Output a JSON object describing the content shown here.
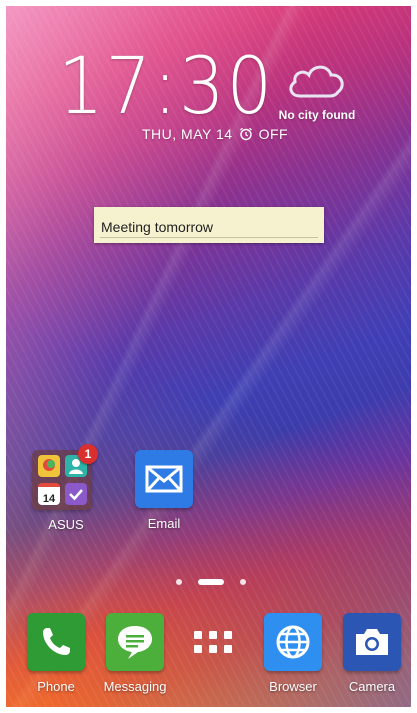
{
  "lockscreen": {
    "time": "17:30",
    "date": "THU, MAY 14",
    "alarm_status": "OFF",
    "weather": {
      "city": "No city found",
      "icon": "cloud-icon"
    }
  },
  "note_widget": {
    "text": "Meeting tomorrow"
  },
  "home_icons": {
    "asus_folder": {
      "label": "ASUS",
      "badge": "1",
      "calendar_day": "14"
    },
    "email": {
      "label": "Email"
    }
  },
  "page_indicator": {
    "current": 2,
    "total": 3
  },
  "dock": {
    "phone": "Phone",
    "messaging": "Messaging",
    "apps_drawer_icon": "apps-grid-icon",
    "browser": "Browser",
    "camera": "Camera"
  },
  "colors": {
    "phone_green": "#2e9b35",
    "messaging_green": "#4caf3c",
    "browser_blue": "#2f8ff0",
    "camera_blue": "#2b56b3",
    "email_blue": "#2f7be6",
    "note_yellow": "#f6f1cf"
  }
}
